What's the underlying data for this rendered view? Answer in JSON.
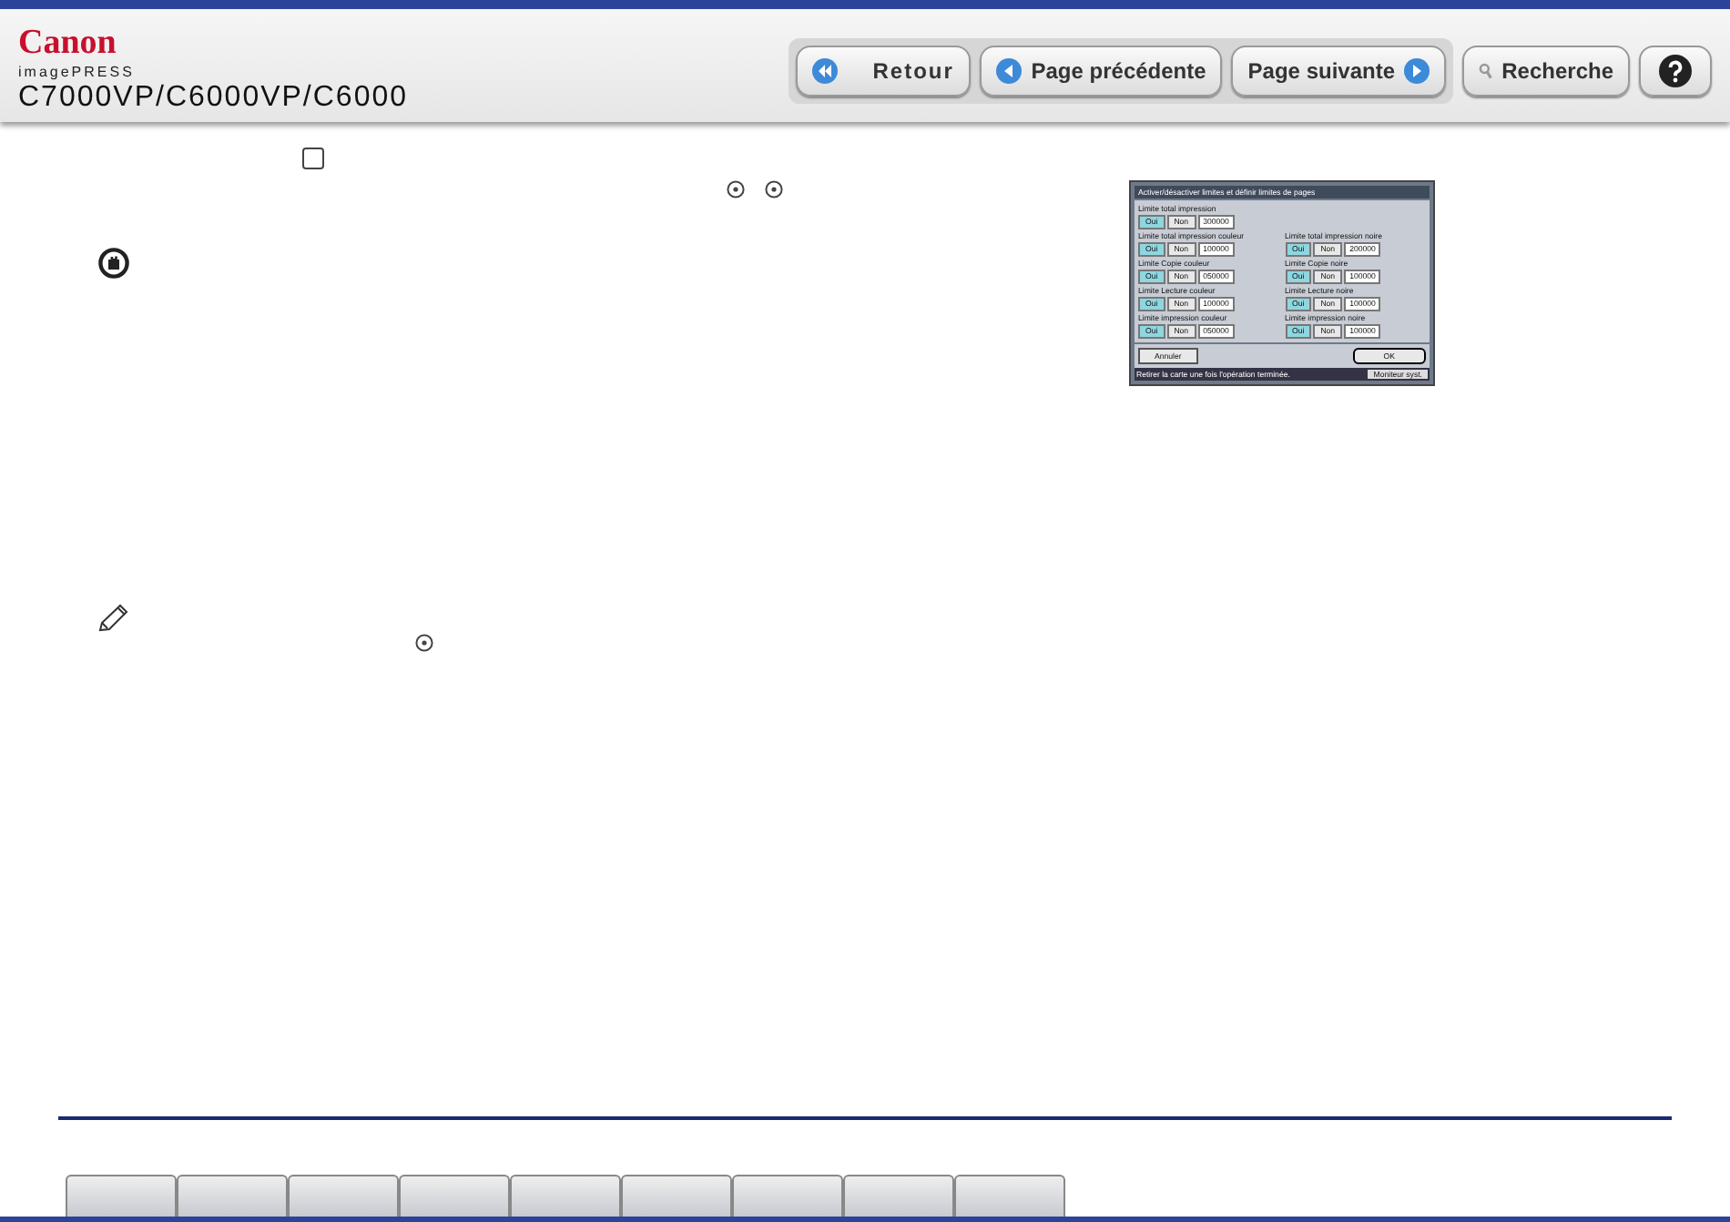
{
  "header": {
    "logo": "Canon",
    "product": "imagePRESS",
    "model": "C7000VP/C6000VP/C6000"
  },
  "nav_buttons": [
    {
      "kind": "back",
      "label": "Retour"
    },
    {
      "kind": "prev",
      "label": "Page précédente"
    },
    {
      "kind": "next",
      "label": "Page suivante"
    },
    {
      "kind": "search",
      "label": "Recherche"
    },
    {
      "kind": "help"
    }
  ],
  "device_screen": {
    "title": "Activer/désactiver limites et définir limites de pages",
    "limits": [
      {
        "label": "Limite total impression",
        "value": "300000",
        "buttons": [
          {
            "label": "Oui",
            "selected": true
          },
          {
            "label": "Non",
            "selected": false
          }
        ]
      },
      {
        "label": "Limite total impression couleur",
        "value": "100000",
        "buttons": [
          {
            "label": "Oui",
            "selected": true
          },
          {
            "label": "Non",
            "selected": false
          }
        ]
      },
      {
        "label": "Limite total impression noire",
        "value": "200000",
        "buttons": [
          {
            "label": "Oui",
            "selected": true
          },
          {
            "label": "Non",
            "selected": false
          }
        ]
      },
      {
        "label": "Limite Copie couleur",
        "value": "050000",
        "buttons": [
          {
            "label": "Oui",
            "selected": true
          },
          {
            "label": "Non",
            "selected": false
          }
        ]
      },
      {
        "label": "Limite Copie noire",
        "value": "100000",
        "buttons": [
          {
            "label": "Oui",
            "selected": true
          },
          {
            "label": "Non",
            "selected": false
          }
        ]
      },
      {
        "label": "Limite Lecture couleur",
        "value": "100000",
        "buttons": [
          {
            "label": "Oui",
            "selected": true
          },
          {
            "label": "Non",
            "selected": false
          }
        ]
      },
      {
        "label": "Limite Lecture noire",
        "value": "100000",
        "buttons": [
          {
            "label": "Oui",
            "selected": true
          },
          {
            "label": "Non",
            "selected": false
          }
        ]
      },
      {
        "label": "Limite impression couleur",
        "value": "050000",
        "buttons": [
          {
            "label": "Oui",
            "selected": true
          },
          {
            "label": "Non",
            "selected": false
          }
        ]
      },
      {
        "label": "Limite impression noire",
        "value": "100000",
        "buttons": [
          {
            "label": "Oui",
            "selected": true
          },
          {
            "label": "Non",
            "selected": false
          }
        ]
      }
    ],
    "cancel": "Annuler",
    "ok": "OK",
    "status": "Retirer la carte une fois l'opération terminée.",
    "monitor": "Moniteur syst."
  }
}
